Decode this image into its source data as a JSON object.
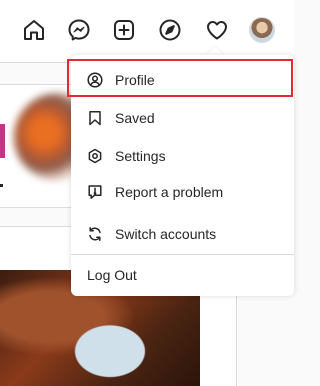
{
  "nav": {
    "icons": [
      "home-icon",
      "messenger-icon",
      "new-post-icon",
      "explore-icon",
      "activity-heart-icon"
    ],
    "profile_avatar": "user-avatar",
    "notification_dot_color": "#ed4956"
  },
  "menu": {
    "items": [
      {
        "label": "Profile",
        "icon": "profile-circle-icon"
      },
      {
        "label": "Saved",
        "icon": "bookmark-icon"
      },
      {
        "label": "Settings",
        "icon": "gear-icon"
      },
      {
        "label": "Report a problem",
        "icon": "report-icon"
      },
      {
        "label": "Switch accounts",
        "icon": "switch-accounts-icon"
      }
    ],
    "logout_label": "Log Out",
    "highlighted_item": "Profile",
    "highlight_color": "#e02b35"
  }
}
